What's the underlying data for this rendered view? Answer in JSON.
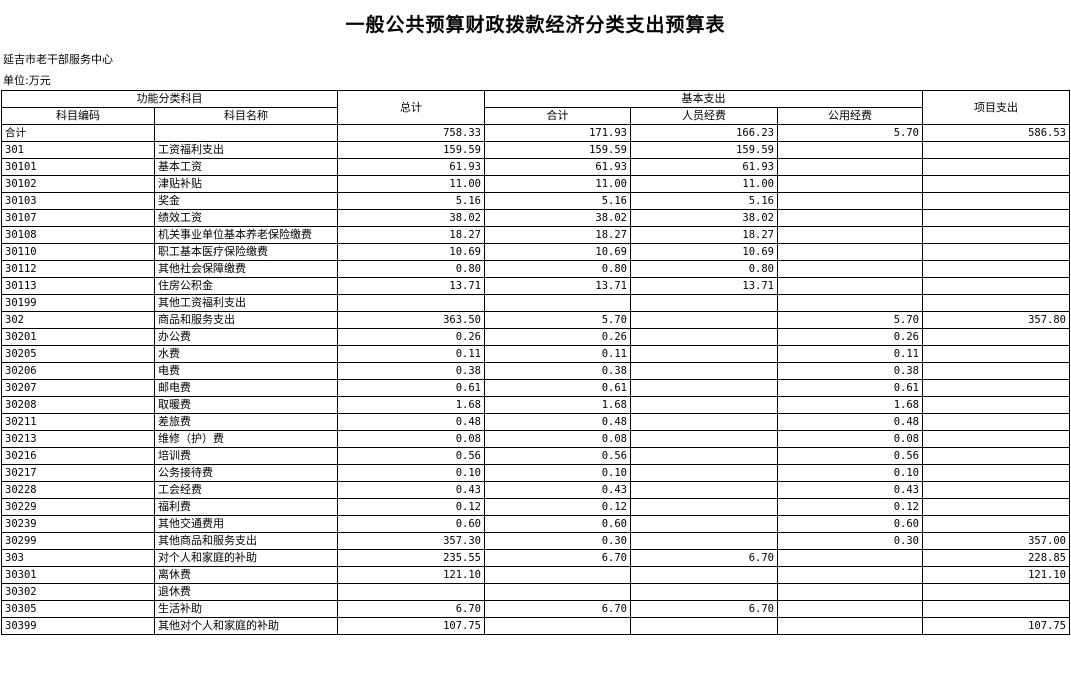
{
  "title": "一般公共预算财政拨款经济分类支出预算表",
  "org": "延吉市老干部服务中心",
  "unit": "单位:万元",
  "headers": {
    "func_group": "功能分类科目",
    "code": "科目编码",
    "name": "科目名称",
    "total": "总计",
    "basic_group": "基本支出",
    "basic_sum": "合计",
    "personnel": "人员经费",
    "public": "公用经费",
    "project": "项目支出"
  },
  "rows": [
    {
      "level": 0,
      "code": "合计",
      "name": "",
      "total": "758.33",
      "basic_sum": "171.93",
      "personnel": "166.23",
      "public": "5.70",
      "project": "586.53"
    },
    {
      "level": 0,
      "code": "301",
      "name": "工资福利支出",
      "total": "159.59",
      "basic_sum": "159.59",
      "personnel": "159.59",
      "public": "",
      "project": ""
    },
    {
      "level": 1,
      "code": "30101",
      "name": "基本工资",
      "total": "61.93",
      "basic_sum": "61.93",
      "personnel": "61.93",
      "public": "",
      "project": ""
    },
    {
      "level": 1,
      "code": "30102",
      "name": "津贴补贴",
      "total": "11.00",
      "basic_sum": "11.00",
      "personnel": "11.00",
      "public": "",
      "project": ""
    },
    {
      "level": 1,
      "code": "30103",
      "name": "奖金",
      "total": "5.16",
      "basic_sum": "5.16",
      "personnel": "5.16",
      "public": "",
      "project": ""
    },
    {
      "level": 1,
      "code": "30107",
      "name": "绩效工资",
      "total": "38.02",
      "basic_sum": "38.02",
      "personnel": "38.02",
      "public": "",
      "project": ""
    },
    {
      "level": 1,
      "code": "30108",
      "name": "机关事业单位基本养老保险缴费",
      "total": "18.27",
      "basic_sum": "18.27",
      "personnel": "18.27",
      "public": "",
      "project": ""
    },
    {
      "level": 1,
      "code": "30110",
      "name": "职工基本医疗保险缴费",
      "total": "10.69",
      "basic_sum": "10.69",
      "personnel": "10.69",
      "public": "",
      "project": ""
    },
    {
      "level": 1,
      "code": "30112",
      "name": "其他社会保障缴费",
      "total": "0.80",
      "basic_sum": "0.80",
      "personnel": "0.80",
      "public": "",
      "project": ""
    },
    {
      "level": 1,
      "code": "30113",
      "name": "住房公积金",
      "total": "13.71",
      "basic_sum": "13.71",
      "personnel": "13.71",
      "public": "",
      "project": ""
    },
    {
      "level": 1,
      "code": "30199",
      "name": "其他工资福利支出",
      "total": "",
      "basic_sum": "",
      "personnel": "",
      "public": "",
      "project": ""
    },
    {
      "level": 0,
      "code": "302",
      "name": "商品和服务支出",
      "total": "363.50",
      "basic_sum": "5.70",
      "personnel": "",
      "public": "5.70",
      "project": "357.80"
    },
    {
      "level": 1,
      "code": "30201",
      "name": "办公费",
      "total": "0.26",
      "basic_sum": "0.26",
      "personnel": "",
      "public": "0.26",
      "project": ""
    },
    {
      "level": 1,
      "code": "30205",
      "name": "水费",
      "total": "0.11",
      "basic_sum": "0.11",
      "personnel": "",
      "public": "0.11",
      "project": ""
    },
    {
      "level": 1,
      "code": "30206",
      "name": "电费",
      "total": "0.38",
      "basic_sum": "0.38",
      "personnel": "",
      "public": "0.38",
      "project": ""
    },
    {
      "level": 1,
      "code": "30207",
      "name": "邮电费",
      "total": "0.61",
      "basic_sum": "0.61",
      "personnel": "",
      "public": "0.61",
      "project": ""
    },
    {
      "level": 1,
      "code": "30208",
      "name": "取暖费",
      "total": "1.68",
      "basic_sum": "1.68",
      "personnel": "",
      "public": "1.68",
      "project": ""
    },
    {
      "level": 1,
      "code": "30211",
      "name": "差旅费",
      "total": "0.48",
      "basic_sum": "0.48",
      "personnel": "",
      "public": "0.48",
      "project": ""
    },
    {
      "level": 1,
      "code": "30213",
      "name": "维修（护）费",
      "total": "0.08",
      "basic_sum": "0.08",
      "personnel": "",
      "public": "0.08",
      "project": ""
    },
    {
      "level": 1,
      "code": "30216",
      "name": "培训费",
      "total": "0.56",
      "basic_sum": "0.56",
      "personnel": "",
      "public": "0.56",
      "project": ""
    },
    {
      "level": 1,
      "code": "30217",
      "name": "公务接待费",
      "total": "0.10",
      "basic_sum": "0.10",
      "personnel": "",
      "public": "0.10",
      "project": ""
    },
    {
      "level": 1,
      "code": "30228",
      "name": "工会经费",
      "total": "0.43",
      "basic_sum": "0.43",
      "personnel": "",
      "public": "0.43",
      "project": ""
    },
    {
      "level": 1,
      "code": "30229",
      "name": "福利费",
      "total": "0.12",
      "basic_sum": "0.12",
      "personnel": "",
      "public": "0.12",
      "project": ""
    },
    {
      "level": 1,
      "code": "30239",
      "name": "其他交通费用",
      "total": "0.60",
      "basic_sum": "0.60",
      "personnel": "",
      "public": "0.60",
      "project": ""
    },
    {
      "level": 1,
      "code": "30299",
      "name": "其他商品和服务支出",
      "total": "357.30",
      "basic_sum": "0.30",
      "personnel": "",
      "public": "0.30",
      "project": "357.00"
    },
    {
      "level": 0,
      "code": "303",
      "name": "对个人和家庭的补助",
      "total": "235.55",
      "basic_sum": "6.70",
      "personnel": "6.70",
      "public": "",
      "project": "228.85"
    },
    {
      "level": 1,
      "code": "30301",
      "name": "离休费",
      "total": "121.10",
      "basic_sum": "",
      "personnel": "",
      "public": "",
      "project": "121.10"
    },
    {
      "level": 1,
      "code": "30302",
      "name": "退休费",
      "total": "",
      "basic_sum": "",
      "personnel": "",
      "public": "",
      "project": ""
    },
    {
      "level": 1,
      "code": "30305",
      "name": "生活补助",
      "total": "6.70",
      "basic_sum": "6.70",
      "personnel": "6.70",
      "public": "",
      "project": ""
    },
    {
      "level": 1,
      "code": "30399",
      "name": "其他对个人和家庭的补助",
      "total": "107.75",
      "basic_sum": "",
      "personnel": "",
      "public": "",
      "project": "107.75"
    }
  ]
}
